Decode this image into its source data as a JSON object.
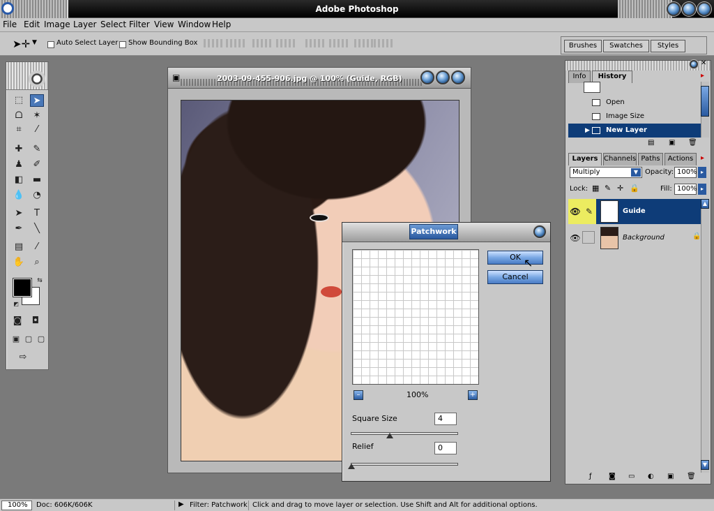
{
  "app": {
    "title": "Adobe Photoshop"
  },
  "menu": [
    "File",
    "Edit",
    "Image",
    "Layer",
    "Select",
    "Filter",
    "View",
    "Window",
    "Help"
  ],
  "options": {
    "auto_select_layer": "Auto Select Layer",
    "show_bounding_box": "Show Bounding Box"
  },
  "palette_well": {
    "tabs": [
      "Brushes",
      "Swatches",
      "Styles"
    ]
  },
  "document": {
    "title": "2003-09-455-906.jpg @ 100% (Guide, RGB)"
  },
  "dialog": {
    "title": "Patchwork",
    "ok": "OK",
    "cancel": "Cancel",
    "zoom_value": "100%",
    "zoom_out": "–",
    "zoom_in": "+",
    "square_size_label": "Square Size",
    "square_size_value": "4",
    "square_size_fraction": 0.36,
    "relief_label": "Relief",
    "relief_value": "0",
    "relief_fraction": 0.0
  },
  "history_panel": {
    "tabs": [
      "Info",
      "History"
    ],
    "rows": [
      "Open",
      "Image Size",
      "New Layer"
    ]
  },
  "layers_panel": {
    "tabs": [
      "Layers",
      "Channels",
      "Paths",
      "Actions"
    ],
    "blend_mode": "Multiply",
    "opacity_label": "Opacity:",
    "opacity_value": "100%",
    "lock_label": "Lock:",
    "fill_label": "Fill:",
    "fill_value": "100%",
    "layers": [
      {
        "name": "Guide"
      },
      {
        "name": "Background"
      }
    ]
  },
  "status": {
    "zoom": "100%",
    "doc": "Doc: 606K/606K",
    "filter": "Filter: Patchwork",
    "hint": "Click and drag to move layer or selection.  Use Shift and Alt for additional options."
  },
  "colors": {
    "accent": "#0e3c78",
    "button_blue": "#4a7cc4",
    "chrome": "#c8c8c8"
  }
}
